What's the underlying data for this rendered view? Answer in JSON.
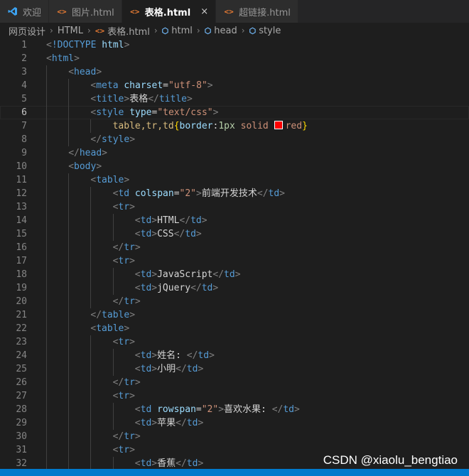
{
  "tabs": [
    {
      "label": "欢迎",
      "icon": "vscode-logo-icon",
      "active": false
    },
    {
      "label": "图片.html",
      "icon": "html-file-icon",
      "active": false
    },
    {
      "label": "表格.html",
      "icon": "html-file-icon",
      "active": true,
      "close": "×"
    },
    {
      "label": "超链接.html",
      "icon": "html-file-icon",
      "active": false
    }
  ],
  "breadcrumb": [
    "网页设计",
    "HTML",
    "表格.html",
    "html",
    "head",
    "style"
  ],
  "editor": {
    "current_line": 6,
    "lines": [
      {
        "n": "1",
        "indent": 0,
        "segs": [
          [
            "t",
            "<"
          ],
          [
            "tg",
            "!DOCTYPE "
          ],
          [
            "at",
            "html"
          ],
          [
            "t",
            ">"
          ]
        ]
      },
      {
        "n": "2",
        "indent": 0,
        "segs": [
          [
            "t",
            "<"
          ],
          [
            "tg",
            "html"
          ],
          [
            "t",
            ">"
          ]
        ]
      },
      {
        "n": "3",
        "indent": 1,
        "segs": [
          [
            "t",
            "<"
          ],
          [
            "tg",
            "head"
          ],
          [
            "t",
            ">"
          ]
        ]
      },
      {
        "n": "4",
        "indent": 2,
        "segs": [
          [
            "t",
            "<"
          ],
          [
            "tg",
            "meta "
          ],
          [
            "at",
            "charset"
          ],
          [
            "tx",
            "="
          ],
          [
            "st",
            "\"utf-8\""
          ],
          [
            "t",
            ">"
          ]
        ]
      },
      {
        "n": "5",
        "indent": 2,
        "segs": [
          [
            "t",
            "<"
          ],
          [
            "tg",
            "title"
          ],
          [
            "t",
            ">"
          ],
          [
            "tx",
            "表格"
          ],
          [
            "t",
            "</"
          ],
          [
            "tg",
            "title"
          ],
          [
            "t",
            ">"
          ]
        ]
      },
      {
        "n": "6",
        "indent": 2,
        "segs": [
          [
            "t",
            "<"
          ],
          [
            "tg",
            "style "
          ],
          [
            "at",
            "type"
          ],
          [
            "tx",
            "="
          ],
          [
            "st",
            "\"text/css\""
          ],
          [
            "t",
            ">"
          ]
        ]
      },
      {
        "n": "7",
        "indent": 3,
        "segs": [
          [
            "sel",
            "table,tr,td"
          ],
          [
            "br",
            "{"
          ],
          [
            "pr",
            "border"
          ],
          [
            "tx",
            ":"
          ],
          [
            "num",
            "1px"
          ],
          [
            "val",
            " solid "
          ],
          [
            "swatch",
            "red-color-swatch"
          ],
          [
            "val",
            "red"
          ],
          [
            "br",
            "}"
          ]
        ]
      },
      {
        "n": "8",
        "indent": 2,
        "segs": [
          [
            "t",
            "</"
          ],
          [
            "tg",
            "style"
          ],
          [
            "t",
            ">"
          ]
        ]
      },
      {
        "n": "9",
        "indent": 1,
        "segs": [
          [
            "t",
            "</"
          ],
          [
            "tg",
            "head"
          ],
          [
            "t",
            ">"
          ]
        ]
      },
      {
        "n": "10",
        "indent": 1,
        "segs": [
          [
            "t",
            "<"
          ],
          [
            "tg",
            "body"
          ],
          [
            "t",
            ">"
          ]
        ]
      },
      {
        "n": "11",
        "indent": 2,
        "segs": [
          [
            "t",
            "<"
          ],
          [
            "tg",
            "table"
          ],
          [
            "t",
            ">"
          ]
        ]
      },
      {
        "n": "12",
        "indent": 3,
        "segs": [
          [
            "t",
            "<"
          ],
          [
            "tg",
            "td "
          ],
          [
            "at",
            "colspan"
          ],
          [
            "tx",
            "="
          ],
          [
            "st",
            "\"2\""
          ],
          [
            "t",
            ">"
          ],
          [
            "tx",
            "前端开发技术"
          ],
          [
            "t",
            "</"
          ],
          [
            "tg",
            "td"
          ],
          [
            "t",
            ">"
          ]
        ]
      },
      {
        "n": "13",
        "indent": 3,
        "segs": [
          [
            "t",
            "<"
          ],
          [
            "tg",
            "tr"
          ],
          [
            "t",
            ">"
          ]
        ]
      },
      {
        "n": "14",
        "indent": 4,
        "segs": [
          [
            "t",
            "<"
          ],
          [
            "tg",
            "td"
          ],
          [
            "t",
            ">"
          ],
          [
            "tx",
            "HTML"
          ],
          [
            "t",
            "</"
          ],
          [
            "tg",
            "td"
          ],
          [
            "t",
            ">"
          ]
        ]
      },
      {
        "n": "15",
        "indent": 4,
        "segs": [
          [
            "t",
            "<"
          ],
          [
            "tg",
            "td"
          ],
          [
            "t",
            ">"
          ],
          [
            "tx",
            "CSS"
          ],
          [
            "t",
            "</"
          ],
          [
            "tg",
            "td"
          ],
          [
            "t",
            ">"
          ]
        ]
      },
      {
        "n": "16",
        "indent": 3,
        "segs": [
          [
            "t",
            "</"
          ],
          [
            "tg",
            "tr"
          ],
          [
            "t",
            ">"
          ]
        ]
      },
      {
        "n": "17",
        "indent": 3,
        "segs": [
          [
            "t",
            "<"
          ],
          [
            "tg",
            "tr"
          ],
          [
            "t",
            ">"
          ]
        ]
      },
      {
        "n": "18",
        "indent": 4,
        "segs": [
          [
            "t",
            "<"
          ],
          [
            "tg",
            "td"
          ],
          [
            "t",
            ">"
          ],
          [
            "tx",
            "JavaScript"
          ],
          [
            "t",
            "</"
          ],
          [
            "tg",
            "td"
          ],
          [
            "t",
            ">"
          ]
        ]
      },
      {
        "n": "19",
        "indent": 4,
        "segs": [
          [
            "t",
            "<"
          ],
          [
            "tg",
            "td"
          ],
          [
            "t",
            ">"
          ],
          [
            "tx",
            "jQuery"
          ],
          [
            "t",
            "</"
          ],
          [
            "tg",
            "td"
          ],
          [
            "t",
            ">"
          ]
        ]
      },
      {
        "n": "20",
        "indent": 3,
        "segs": [
          [
            "t",
            "</"
          ],
          [
            "tg",
            "tr"
          ],
          [
            "t",
            ">"
          ]
        ]
      },
      {
        "n": "21",
        "indent": 2,
        "segs": [
          [
            "t",
            "</"
          ],
          [
            "tg",
            "table"
          ],
          [
            "t",
            ">"
          ]
        ]
      },
      {
        "n": "22",
        "indent": 2,
        "segs": [
          [
            "t",
            "<"
          ],
          [
            "tg",
            "table"
          ],
          [
            "t",
            ">"
          ]
        ]
      },
      {
        "n": "23",
        "indent": 3,
        "segs": [
          [
            "t",
            "<"
          ],
          [
            "tg",
            "tr"
          ],
          [
            "t",
            ">"
          ]
        ]
      },
      {
        "n": "24",
        "indent": 4,
        "segs": [
          [
            "t",
            "<"
          ],
          [
            "tg",
            "td"
          ],
          [
            "t",
            ">"
          ],
          [
            "tx",
            "姓名: "
          ],
          [
            "t",
            "</"
          ],
          [
            "tg",
            "td"
          ],
          [
            "t",
            ">"
          ]
        ]
      },
      {
        "n": "25",
        "indent": 4,
        "segs": [
          [
            "t",
            "<"
          ],
          [
            "tg",
            "td"
          ],
          [
            "t",
            ">"
          ],
          [
            "tx",
            "小明"
          ],
          [
            "t",
            "</"
          ],
          [
            "tg",
            "td"
          ],
          [
            "t",
            ">"
          ]
        ]
      },
      {
        "n": "26",
        "indent": 3,
        "segs": [
          [
            "t",
            "</"
          ],
          [
            "tg",
            "tr"
          ],
          [
            "t",
            ">"
          ]
        ]
      },
      {
        "n": "27",
        "indent": 3,
        "segs": [
          [
            "t",
            "<"
          ],
          [
            "tg",
            "tr"
          ],
          [
            "t",
            ">"
          ]
        ]
      },
      {
        "n": "28",
        "indent": 4,
        "segs": [
          [
            "t",
            "<"
          ],
          [
            "tg",
            "td "
          ],
          [
            "at",
            "rowspan"
          ],
          [
            "tx",
            "="
          ],
          [
            "st",
            "\"2\""
          ],
          [
            "t",
            ">"
          ],
          [
            "tx",
            "喜欢水果: "
          ],
          [
            "t",
            "</"
          ],
          [
            "tg",
            "td"
          ],
          [
            "t",
            ">"
          ]
        ]
      },
      {
        "n": "29",
        "indent": 4,
        "segs": [
          [
            "t",
            "<"
          ],
          [
            "tg",
            "td"
          ],
          [
            "t",
            ">"
          ],
          [
            "tx",
            "苹果"
          ],
          [
            "t",
            "</"
          ],
          [
            "tg",
            "td"
          ],
          [
            "t",
            ">"
          ]
        ]
      },
      {
        "n": "30",
        "indent": 3,
        "segs": [
          [
            "t",
            "</"
          ],
          [
            "tg",
            "tr"
          ],
          [
            "t",
            ">"
          ]
        ]
      },
      {
        "n": "31",
        "indent": 3,
        "segs": [
          [
            "t",
            "<"
          ],
          [
            "tg",
            "tr"
          ],
          [
            "t",
            ">"
          ]
        ]
      },
      {
        "n": "32",
        "indent": 4,
        "segs": [
          [
            "t",
            "<"
          ],
          [
            "tg",
            "td"
          ],
          [
            "t",
            ">"
          ],
          [
            "tx",
            "香蕉"
          ],
          [
            "t",
            "</"
          ],
          [
            "tg",
            "td"
          ],
          [
            "t",
            ">"
          ]
        ]
      }
    ]
  },
  "watermark": "CSDN @xiaolu_bengtiao",
  "colors": {
    "status_bar": "#007acc",
    "tag": "#569cd6",
    "attribute": "#9cdcfe",
    "string": "#ce9178",
    "selector": "#d7ba7d"
  }
}
